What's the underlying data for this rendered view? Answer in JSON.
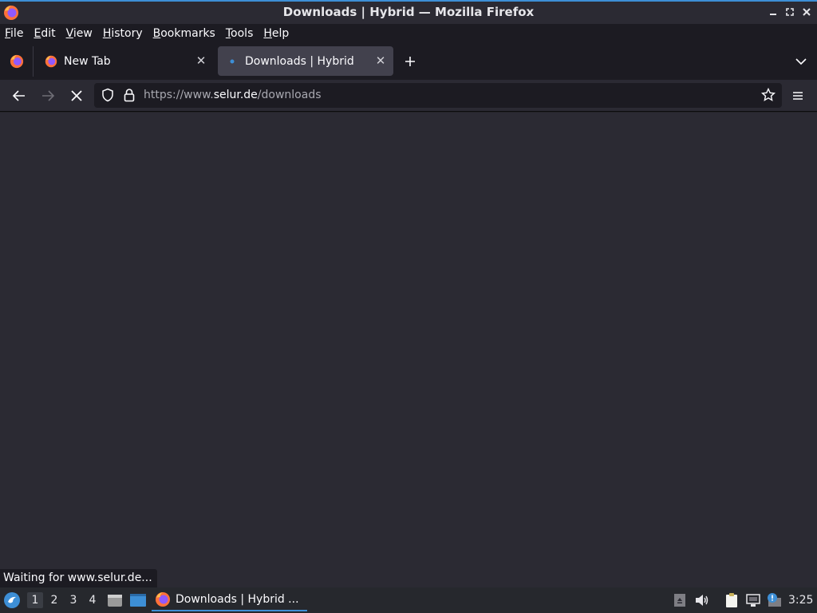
{
  "window": {
    "title": "Downloads | Hybrid — Mozilla Firefox",
    "controls": [
      "minimize",
      "maximize",
      "close"
    ]
  },
  "menubar": {
    "items": [
      {
        "label": "File"
      },
      {
        "label": "Edit"
      },
      {
        "label": "View"
      },
      {
        "label": "History"
      },
      {
        "label": "Bookmarks"
      },
      {
        "label": "Tools"
      },
      {
        "label": "Help"
      }
    ]
  },
  "tabs": [
    {
      "label": "New Tab",
      "icon": "firefox-icon",
      "selected": false
    },
    {
      "label": "Downloads | Hybrid",
      "icon": "loading-dot-icon",
      "selected": true
    }
  ],
  "navbar": {
    "url_prefix": "https://www.",
    "url_host": "selur.de",
    "url_path": "/downloads",
    "loading": true
  },
  "status": {
    "text": "Waiting for www.selur.de..."
  },
  "taskbar": {
    "workspaces": [
      "1",
      "2",
      "3",
      "4"
    ],
    "active_workspace": "1",
    "task_label": "Downloads | Hybrid ...",
    "clock": "3:25"
  },
  "colors": {
    "accent": "#3d8fd6",
    "background": "#2b2a33",
    "toolbar": "#1c1b22"
  }
}
